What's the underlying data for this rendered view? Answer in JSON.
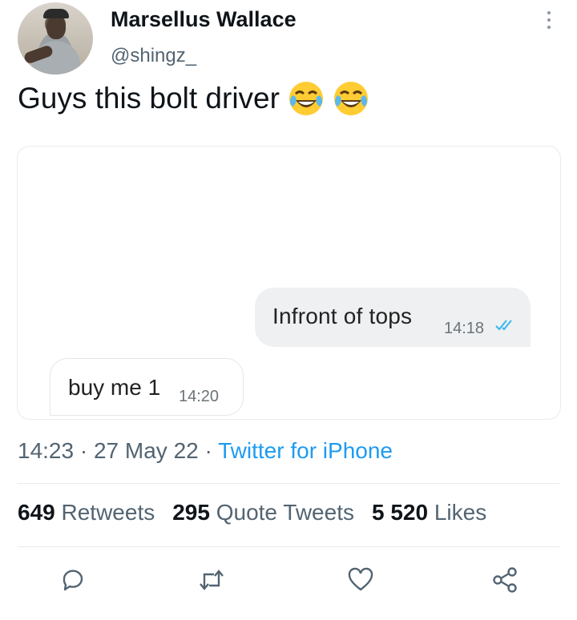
{
  "author": {
    "display_name": "Marsellus Wallace",
    "handle": "@shingz_"
  },
  "tweet": {
    "text": "Guys this bolt driver",
    "emojis": [
      "face-with-tears-of-joy",
      "face-with-tears-of-joy"
    ]
  },
  "chat": {
    "outgoing": {
      "text": "Infront  of tops",
      "time": "14:18",
      "status": "read-double-check"
    },
    "incoming": {
      "text": "buy me 1",
      "time": "14:20"
    }
  },
  "meta": {
    "time": "14:23",
    "sep1": "·",
    "date": "27 May 22",
    "sep2": "·",
    "source": "Twitter for iPhone"
  },
  "stats": {
    "retweets_count": "649",
    "retweets_label": "Retweets",
    "quotes_count": "295",
    "quotes_label": "Quote Tweets",
    "likes_count": "5 520",
    "likes_label": "Likes"
  },
  "colors": {
    "accent": "#1d9bf0",
    "text": "#0f1419",
    "muted": "#536471",
    "check": "#34b7f1"
  }
}
